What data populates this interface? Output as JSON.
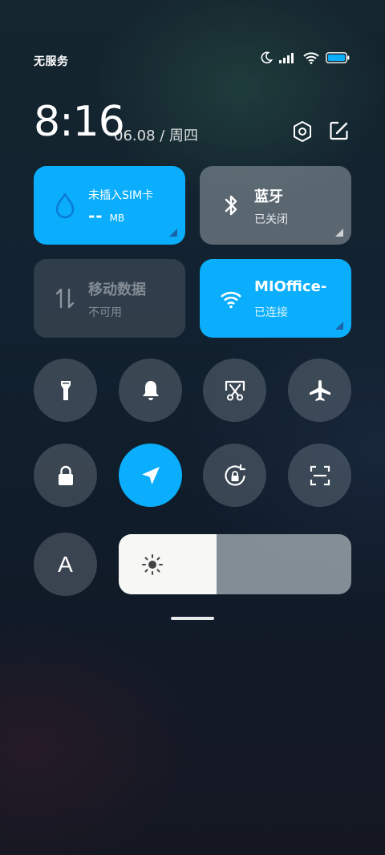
{
  "status_bar": {
    "carrier": "无服务",
    "icons": [
      "moon-icon",
      "signal-icon",
      "wifi-icon",
      "battery-icon"
    ]
  },
  "header": {
    "time": "8:16",
    "date": "06.08 / 周四",
    "icons": [
      "settings-icon",
      "edit-icon"
    ]
  },
  "tiles": {
    "sim": {
      "title": "未插入SIM卡",
      "value": "-- ",
      "unit": "MB",
      "icon": "water-drop-icon"
    },
    "bluetooth": {
      "title": "蓝牙",
      "status": "已关闭",
      "icon": "bluetooth-icon"
    },
    "mobile_data": {
      "title": "移动数据",
      "status": "不可用",
      "icon": "data-arrows-icon"
    },
    "wifi": {
      "title": "MIOffice-",
      "status": "已连接",
      "icon": "wifi-icon"
    }
  },
  "toggles_row1": [
    "flashlight-icon",
    "bell-icon",
    "screenshot-icon",
    "airplane-icon"
  ],
  "toggles_row2": [
    "lock-icon",
    "location-icon",
    "rotation-lock-icon",
    "scan-icon"
  ],
  "auto_brightness": {
    "label": "A"
  },
  "brightness": {
    "level": 0.42
  },
  "colors": {
    "accent": "#0aaefc"
  }
}
